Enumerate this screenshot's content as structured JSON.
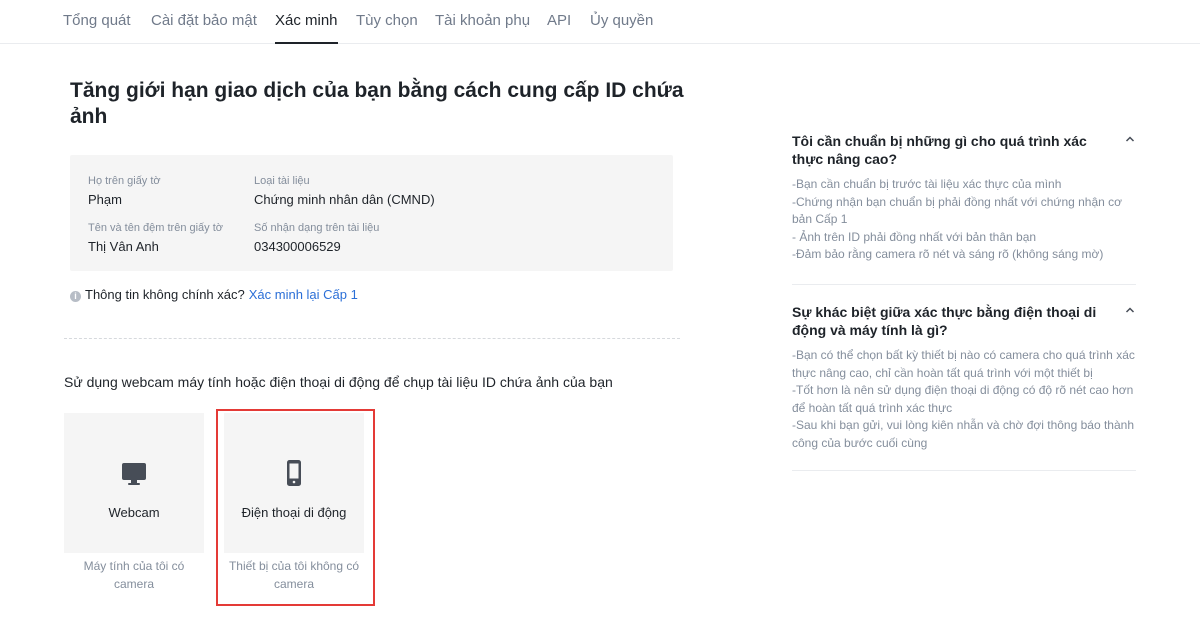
{
  "tabs": [
    {
      "label": "Tổng quát"
    },
    {
      "label": "Cài đặt bảo mật"
    },
    {
      "label": "Xác minh"
    },
    {
      "label": "Tùy chọn"
    },
    {
      "label": "Tài khoản phụ"
    },
    {
      "label": "API"
    },
    {
      "label": "Ủy quyền"
    }
  ],
  "active_tab": "Xác minh",
  "main": {
    "title": "Tăng giới hạn giao dịch của bạn bằng cách cung cấp ID chứa ảnh",
    "fields": [
      {
        "label": "Họ trên giấy tờ",
        "value": "Phạm"
      },
      {
        "label": "Loại tài liệu",
        "value": "Chứng minh nhân dân (CMND)"
      },
      {
        "label": "Tên và tên đệm trên giấy tờ",
        "value": "Thị Vân Anh"
      },
      {
        "label": "Số nhận dạng trên tài liệu",
        "value": "034300006529"
      }
    ],
    "notice_text": "Thông tin không chính xác?",
    "notice_link": "Xác minh lại Cấp 1",
    "capture_heading": "Sử dụng webcam máy tính hoặc điện thoại di động để chụp tài liệu ID chứa ảnh của bạn",
    "options": [
      {
        "label": "Webcam",
        "desc": "Máy tính của tôi có camera",
        "icon": "monitor-icon"
      },
      {
        "label": "Điện thoại di động",
        "desc": "Thiết bị của tôi không có camera",
        "icon": "smartphone-icon"
      }
    ]
  },
  "faq": [
    {
      "question": "Tôi cần chuẩn bị những gì cho quá trình xác thực nâng cao?",
      "lines": [
        "-Bạn cần chuẩn bị trước tài liệu xác thực của mình",
        "-Chứng nhận bạn chuẩn bị phải đồng nhất với chứng nhận cơ bản Cấp 1",
        "- Ảnh trên ID phải đồng nhất với bản thân bạn",
        "-Đảm bảo rằng camera rõ nét và sáng rõ (không sáng mờ)"
      ]
    },
    {
      "question": "Sự khác biệt giữa xác thực bằng điện thoại di động và máy tính là gì?",
      "lines": [
        "-Bạn có thể chọn bất kỳ thiết bị nào có camera cho quá trình xác thực nâng cao, chỉ cần hoàn tất quá trình với một thiết bị",
        "-Tốt hơn là nên sử dụng điện thoại di động có độ rõ nét cao hơn để hoàn tất quá trình xác thực",
        "-Sau khi bạn gửi, vui lòng kiên nhẫn và chờ đợi thông báo thành công của bước cuối cùng"
      ]
    }
  ],
  "colors": {
    "accent_link": "#2b6fd7",
    "highlight_border": "#e43a36",
    "card_background": "#f5f5f5",
    "icon_color": "#474d57"
  }
}
